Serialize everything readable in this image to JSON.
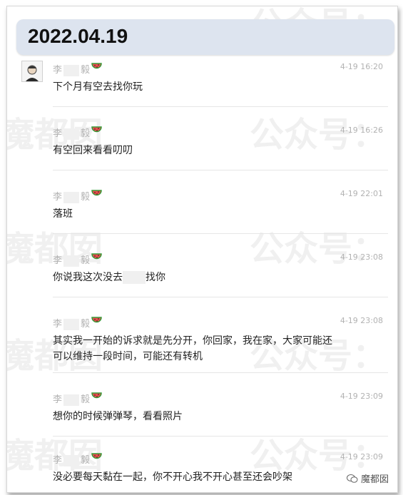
{
  "date": "2022.04.19",
  "watermark": {
    "left": "魔都囡",
    "right": "公众号："
  },
  "brand": {
    "label": "魔都囡"
  },
  "messages": [
    {
      "name_first": "李",
      "name_last": "毅",
      "time": "4-19 16:20",
      "lines": [
        "下个月有空去找你玩"
      ]
    },
    {
      "name_first": "李",
      "name_last": "毅",
      "time": "4-19 16:26",
      "lines": [
        "有空回来看看叨叨"
      ]
    },
    {
      "name_first": "李",
      "name_last": "毅",
      "time": "4-19 22:01",
      "lines": [
        "落班"
      ]
    },
    {
      "name_first": "李",
      "name_last": "毅",
      "time": "4-19 23:08",
      "part_a": "你说我这次没去",
      "part_b": "找你"
    },
    {
      "name_first": "李",
      "name_last": "毅",
      "time": "4-19 23:08",
      "lines": [
        "其实我一开始的诉求就是先分开，你回家，我在家，大家可能还",
        "可以维持一段时间，可能还有转机"
      ]
    },
    {
      "name_first": "李",
      "name_last": "毅",
      "time": "4-19 23:09",
      "lines": [
        "想你的时候弹弹琴，看看照片"
      ]
    },
    {
      "name_first": "李",
      "name_last": "毅",
      "time": "4-19 23:09",
      "lines": [
        "没必要每天黏在一起，你不开心我不开心甚至还会吵架"
      ]
    }
  ]
}
